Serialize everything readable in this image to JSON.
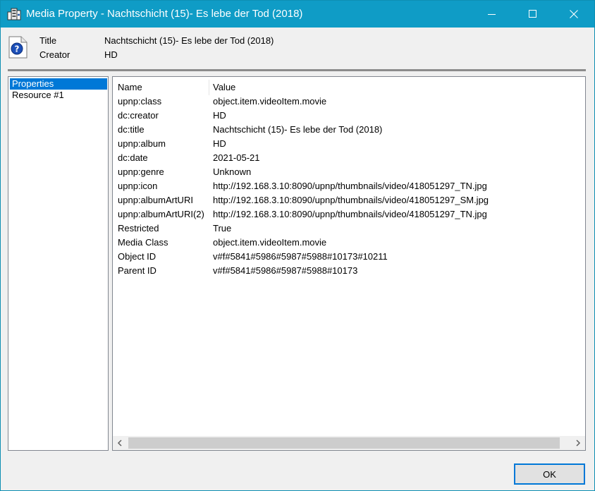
{
  "window": {
    "title": "Media Property - Nachtschicht (15)- Es lebe der Tod (2018)"
  },
  "icons": {
    "app": "media-server-icon",
    "header": "question-document-icon",
    "minimize": "minimize-icon",
    "maximize": "maximize-icon",
    "close": "close-icon",
    "scroll_left": "chevron-left-icon",
    "scroll_right": "chevron-right-icon"
  },
  "header": {
    "title_label": "Title",
    "title_value": "Nachtschicht (15)- Es lebe der Tod (2018)",
    "creator_label": "Creator",
    "creator_value": "HD"
  },
  "tree": {
    "items": [
      {
        "label": "Properties",
        "selected": true
      },
      {
        "label": "Resource #1",
        "selected": false
      }
    ]
  },
  "table": {
    "columns": [
      "Name",
      "Value"
    ],
    "rows": [
      {
        "name": "upnp:class",
        "value": "object.item.videoItem.movie"
      },
      {
        "name": "dc:creator",
        "value": "HD"
      },
      {
        "name": "dc:title",
        "value": "Nachtschicht (15)- Es lebe der Tod (2018)"
      },
      {
        "name": "upnp:album",
        "value": "HD"
      },
      {
        "name": "dc:date",
        "value": "2021-05-21"
      },
      {
        "name": "upnp:genre",
        "value": "Unknown"
      },
      {
        "name": "upnp:icon",
        "value": "http://192.168.3.10:8090/upnp/thumbnails/video/418051297_TN.jpg"
      },
      {
        "name": "upnp:albumArtURI",
        "value": "http://192.168.3.10:8090/upnp/thumbnails/video/418051297_SM.jpg"
      },
      {
        "name": "upnp:albumArtURI(2)",
        "value": "http://192.168.3.10:8090/upnp/thumbnails/video/418051297_TN.jpg"
      },
      {
        "name": "Restricted",
        "value": "True"
      },
      {
        "name": "Media Class",
        "value": "object.item.videoItem.movie"
      },
      {
        "name": "Object ID",
        "value": "v#f#5841#5986#5987#5988#10173#10211"
      },
      {
        "name": "Parent ID",
        "value": "v#f#5841#5986#5987#5988#10173"
      }
    ]
  },
  "buttons": {
    "ok": "OK"
  },
  "colors": {
    "titlebar": "#0f9cc6",
    "selection": "#0078d7"
  }
}
